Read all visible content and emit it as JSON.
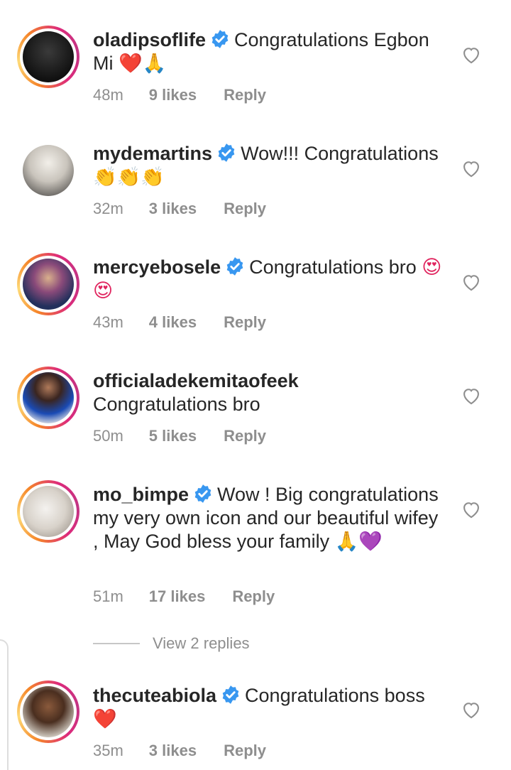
{
  "comments": [
    {
      "username": "oladipsoflife",
      "verified": true,
      "text": "Congratulations Egbon Mi",
      "emoji": "❤️🙏",
      "time": "48m",
      "likes": "9 likes",
      "reply": "Reply"
    },
    {
      "username": "mydemartins",
      "verified": true,
      "text": "Wow!!! Congratulations",
      "emoji": "👏👏👏",
      "time": "32m",
      "likes": "3 likes",
      "reply": "Reply"
    },
    {
      "username": "mercyebosele",
      "verified": true,
      "text": "Congratulations bro",
      "emoji": "😍😍",
      "time": "43m",
      "likes": "4 likes",
      "reply": "Reply"
    },
    {
      "username": "officialadekemitaofeek",
      "verified": false,
      "text": "Congratulations bro",
      "emoji": "",
      "time": "50m",
      "likes": "5 likes",
      "reply": "Reply"
    },
    {
      "username": "mo_bimpe",
      "verified": true,
      "text": "Wow ! Big congratulations my very own icon and our beautiful wifey , May God bless your family",
      "emoji": "🙏💜",
      "time": "51m",
      "likes": "17 likes",
      "reply": "Reply"
    },
    {
      "username": "thecuteabiola",
      "verified": true,
      "text": "Congratulations boss",
      "emoji": "❤️",
      "time": "35m",
      "likes": "3 likes",
      "reply": "Reply"
    }
  ],
  "view_replies": "View 2 replies",
  "icons": {
    "like": "heart-outline-icon",
    "verified": "verified-badge-icon"
  },
  "colors": {
    "verified_blue": "#3897f0",
    "meta_gray": "#8e8e8e",
    "text": "#262626"
  }
}
